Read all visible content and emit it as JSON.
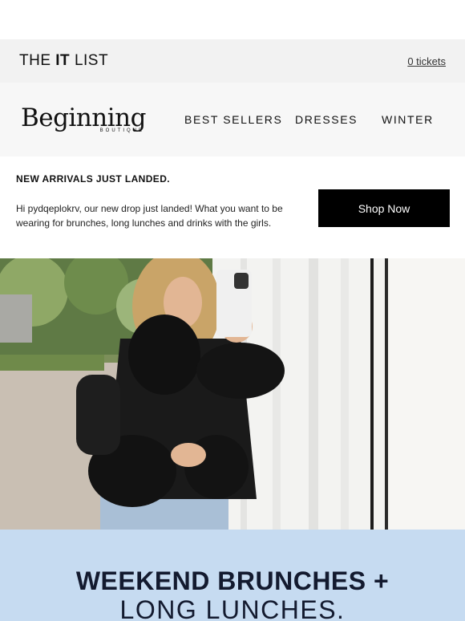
{
  "it_bar": {
    "title_pre": "THE ",
    "title_bold": "IT",
    "title_post": " LIST",
    "tickets": "0 tickets"
  },
  "brand": {
    "logo_main": "Beginning",
    "logo_sub": "BOUTIQUE"
  },
  "nav": {
    "items": [
      {
        "label": "BEST SELLERS"
      },
      {
        "label": "DRESSES"
      },
      {
        "label": "WINTER"
      }
    ]
  },
  "promo": {
    "heading": "NEW ARRIVALS JUST LANDED.",
    "body": "Hi pydqeplokrv, our new drop just landed! What you want to be wearing for brunches, long lunches and drinks with the girls.",
    "button_label": "Shop Now"
  },
  "banner": {
    "line1": "WEEKEND BRUNCHES +",
    "line2": "LONG LUNCHES."
  },
  "colors": {
    "banner_bg": "#c6dbf1",
    "banner_text": "#131a2f",
    "button_bg": "#000000"
  }
}
